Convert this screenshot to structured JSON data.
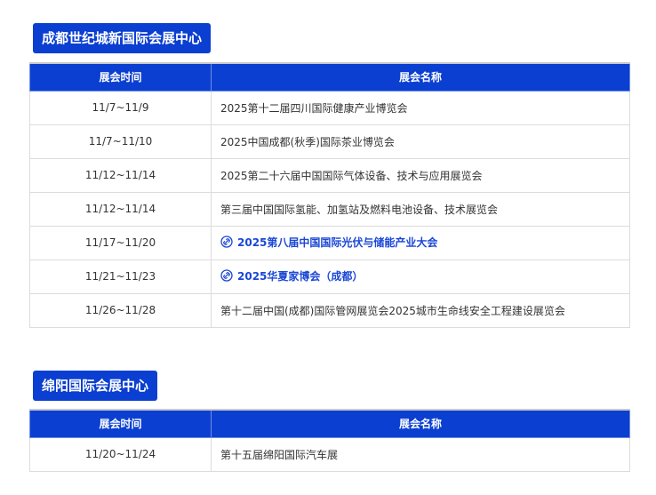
{
  "sections": [
    {
      "title": "成都世纪城新国际会展中心",
      "headers": {
        "date": "展会时间",
        "name": "展会名称"
      },
      "rows": [
        {
          "date": "11/7~11/9",
          "name": "2025第十二届四川国际健康产业博览会",
          "link": false
        },
        {
          "date": "11/7~11/10",
          "name": "2025中国成都(秋季)国际茶业博览会",
          "link": false
        },
        {
          "date": "11/12~11/14",
          "name": "2025第二十六届中国国际气体设备、技术与应用展览会",
          "link": false
        },
        {
          "date": "11/12~11/14",
          "name": "第三届中国国际氢能、加氢站及燃料电池设备、技术展览会",
          "link": false
        },
        {
          "date": "11/17~11/20",
          "name": "2025第八届中国国际光伏与储能产业大会",
          "link": true
        },
        {
          "date": "11/21~11/23",
          "name": "2025华夏家博会（成都）",
          "link": true
        },
        {
          "date": "11/26~11/28",
          "name": "第十二届中国(成都)国际管网展览会2025城市生命线安全工程建设展览会",
          "link": false
        }
      ]
    },
    {
      "title": "绵阳国际会展中心",
      "headers": {
        "date": "展会时间",
        "name": "展会名称"
      },
      "rows": [
        {
          "date": "11/20~11/24",
          "name": "第十五届绵阳国际汽车展",
          "link": false
        }
      ]
    }
  ],
  "colors": {
    "accent": "#0b3fd1",
    "link": "#1a47d6"
  },
  "icons": {
    "link_icon": "link-icon"
  }
}
